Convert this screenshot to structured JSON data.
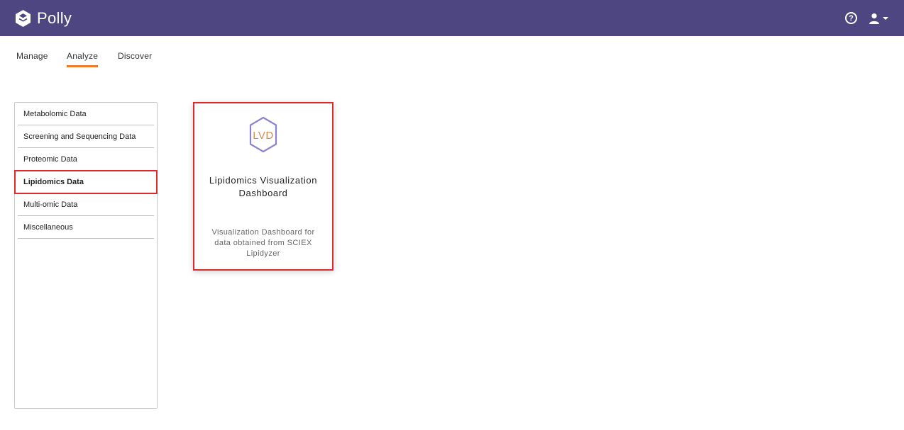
{
  "header": {
    "brand_name": "Polly",
    "brand_icon": "polly-logo-icon",
    "help_icon": "question-circle-icon",
    "help_glyph": "?",
    "user_icon": "user-icon",
    "colors": {
      "bar": "#4e4681",
      "accent": "#f07a2c",
      "highlight": "#e0292f"
    }
  },
  "nav": {
    "tabs": [
      {
        "label": "Manage",
        "active": false
      },
      {
        "label": "Analyze",
        "active": true
      },
      {
        "label": "Discover",
        "active": false
      }
    ]
  },
  "categories": {
    "items": [
      {
        "label": "Metabolomic Data",
        "selected": false
      },
      {
        "label": "Screening and Sequencing Data",
        "selected": false
      },
      {
        "label": "Proteomic Data",
        "selected": false
      },
      {
        "label": "Lipidomics Data",
        "selected": true
      },
      {
        "label": "Multi-omic Data",
        "selected": false
      },
      {
        "label": "Miscellaneous",
        "selected": false
      }
    ]
  },
  "apps": [
    {
      "icon_text": "LVD",
      "icon": "lvd-hexagon-icon",
      "title": "Lipidomics Visualization Dashboard",
      "description": "Visualization Dashboard for data obtained from SCIEX Lipidyzer"
    }
  ]
}
